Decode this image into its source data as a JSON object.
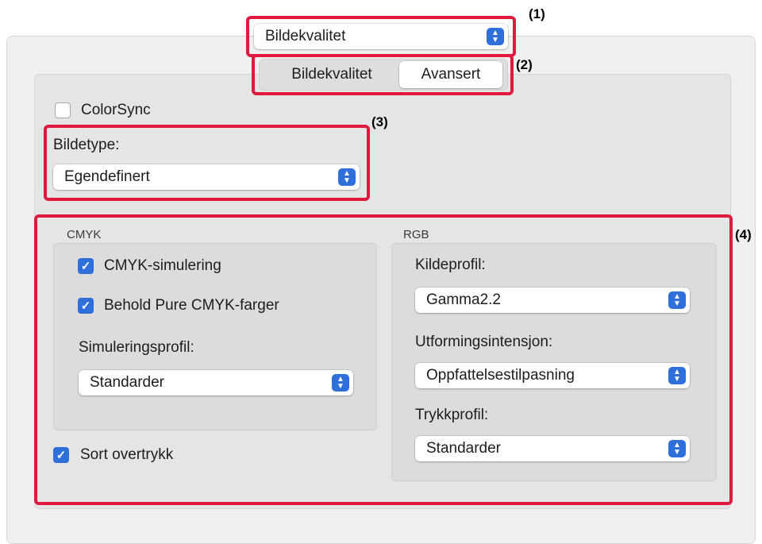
{
  "top_popup": {
    "value": "Bildekvalitet"
  },
  "tabs": [
    {
      "label": "Bildekvalitet",
      "active": false
    },
    {
      "label": "Avansert",
      "active": true
    }
  ],
  "colorsync": {
    "label": "ColorSync",
    "checked": false
  },
  "image_type": {
    "label": "Bildetype:",
    "value": "Egendefinert"
  },
  "cmyk": {
    "heading": "CMYK",
    "simulation": {
      "label": "CMYK-simulering",
      "checked": true
    },
    "keep_pure": {
      "label": "Behold Pure CMYK-farger",
      "checked": true
    },
    "profile_label": "Simuleringsprofil:",
    "profile_value": "Standarder"
  },
  "black_overprint": {
    "label": "Sort overtrykk",
    "checked": true
  },
  "rgb": {
    "heading": "RGB",
    "source_label": "Kildeprofil:",
    "source_value": "Gamma2.2",
    "intent_label": "Utformingsintensjon:",
    "intent_value": "Oppfattelsestilpasning",
    "print_label": "Trykkprofil:",
    "print_value": "Standarder"
  },
  "annotations": [
    "(1)",
    "(2)",
    "(3)",
    "(4)"
  ],
  "colors": {
    "accent": "#2f6fd9",
    "annotation_red": "#e0193f"
  }
}
